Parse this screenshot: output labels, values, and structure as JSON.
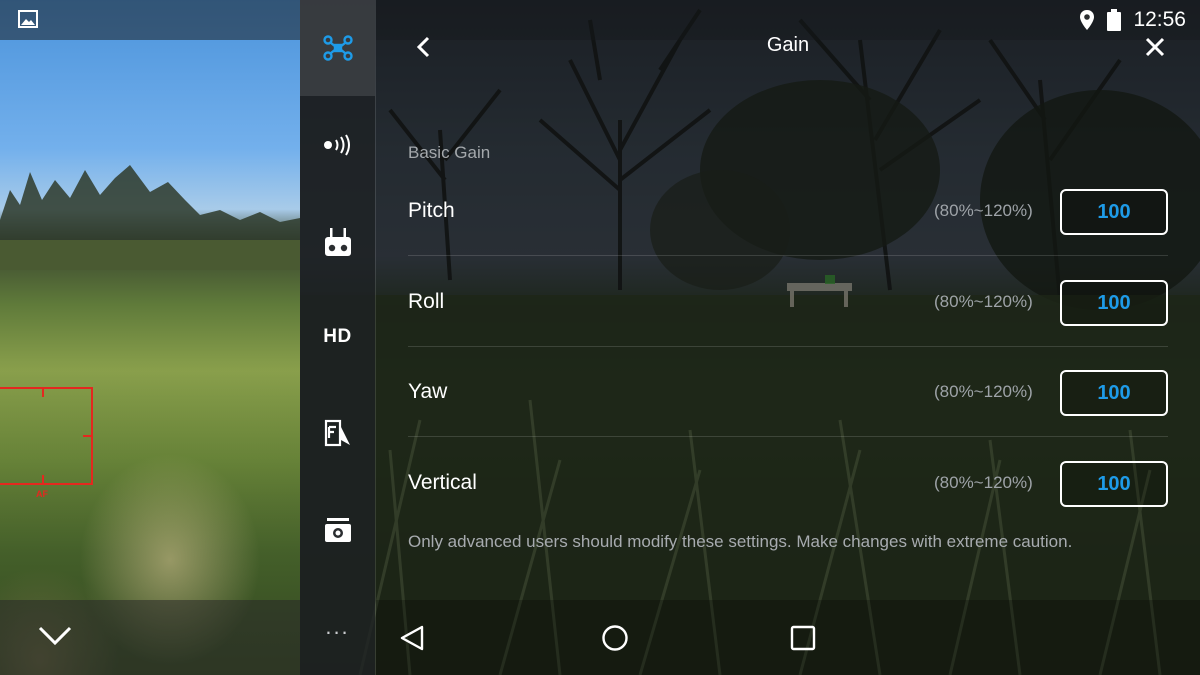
{
  "status_bar": {
    "time": "12:56",
    "icons": [
      "location-icon",
      "battery-icon"
    ]
  },
  "header": {
    "title": "Gain",
    "icons": [
      "back-icon",
      "close-icon"
    ]
  },
  "sidebar": {
    "items": [
      {
        "name": "aircraft-icon",
        "active": true
      },
      {
        "name": "signal-icon"
      },
      {
        "name": "remote-controller-icon"
      },
      {
        "name": "hd-icon",
        "label": "HD"
      },
      {
        "name": "map-icon"
      },
      {
        "name": "camera-icon"
      }
    ],
    "more": "..."
  },
  "settings": {
    "section_label": "Basic Gain",
    "rows": [
      {
        "label": "Pitch",
        "range": "(80%~120%)",
        "value": "100"
      },
      {
        "label": "Roll",
        "range": "(80%~120%)",
        "value": "100"
      },
      {
        "label": "Yaw",
        "range": "(80%~120%)",
        "value": "100"
      },
      {
        "label": "Vertical",
        "range": "(80%~120%)",
        "value": "100"
      }
    ],
    "warning": "Only advanced users should modify these settings. Make changes with extreme caution."
  },
  "camera": {
    "focus_label": "AF"
  },
  "colors": {
    "accent": "#1e9be8",
    "focus_box": "#e4281f"
  }
}
